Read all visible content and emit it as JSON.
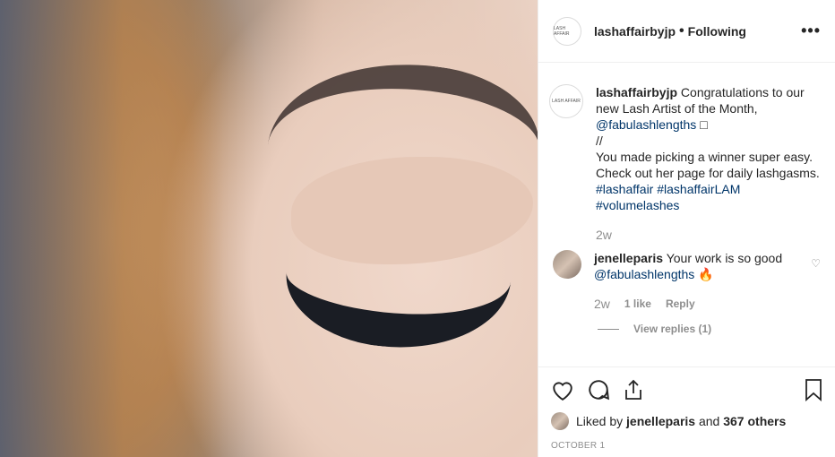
{
  "post": {
    "author": "lashaffairbyjp",
    "separator": "•",
    "follow_status": "Following",
    "more_icon": "more-icon",
    "avatar_text": "LASH AFFAIR"
  },
  "caption": {
    "username": "lashaffairbyjp",
    "text1": "Congratulations to our new Lash Artist of the Month, ",
    "mention": "@fabulashlengths",
    "box": "□",
    "sep": "//",
    "text2": "You made picking a winner super easy. Check out her page for daily lashgasms.",
    "hashtags": "#lashaffair #lashaffairLAM #volumelashes",
    "time": "2w"
  },
  "comment": {
    "username": "jenelleparis",
    "text": "Your work is so good",
    "mention": "@fabulashlengths",
    "emoji": "🔥",
    "time": "2w",
    "likes": "1 like",
    "reply": "Reply",
    "view_replies": "View replies (1)"
  },
  "actions": {
    "icons": [
      "heart-icon",
      "comment-icon",
      "share-icon",
      "bookmark-icon"
    ],
    "liked_by_prefix": "Liked by ",
    "liked_by_user": "jenelleparis",
    "liked_by_mid": " and ",
    "liked_by_count": "367 others",
    "date": "OCTOBER 1"
  }
}
